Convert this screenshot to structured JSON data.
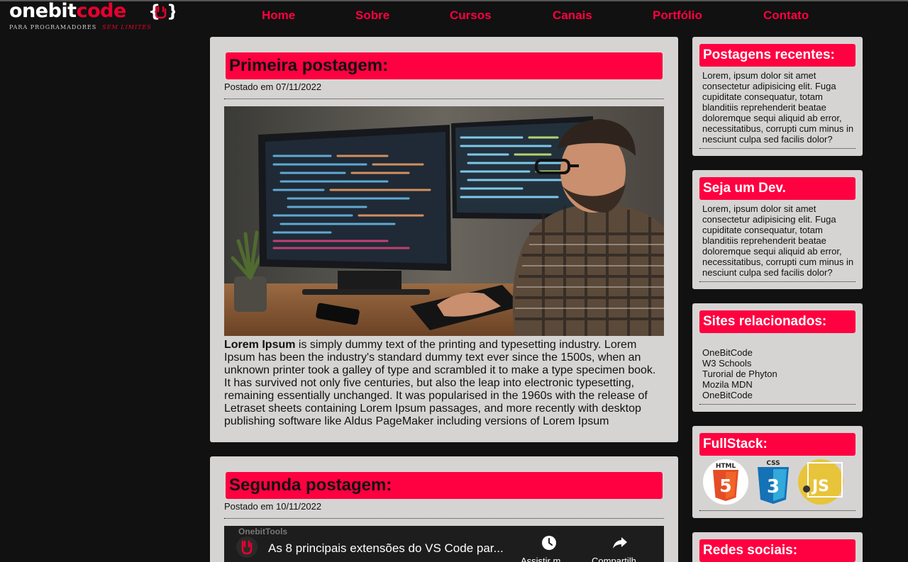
{
  "logo": {
    "part1": "onebit",
    "part2": "code",
    "tagline": "PARA PROGRAMADORES",
    "tagline_em": "SEM LIMITES"
  },
  "nav": [
    "Home",
    "Sobre",
    "Cursos",
    "Canais",
    "Portfólio",
    "Contato"
  ],
  "posts": [
    {
      "title": "Primeira postagem:",
      "date": "Postado em 07/11/2022",
      "text_bold": "Lorem Ipsum",
      "text": " is simply dummy text of the printing and typesetting industry. Lorem Ipsum has been the industry's standard dummy text ever since the 1500s, when an unknown printer took a galley of type and scrambled it to make a type specimen book. It has survived not only five centuries, but also the leap into electronic typesetting, remaining essentially unchanged. It was popularised in the 1960s with the release of Letraset sheets containing Lorem Ipsum passages, and more recently with desktop publishing software like Aldus PageMaker including versions of Lorem Ipsum"
    },
    {
      "title": "Segunda postagem:",
      "date": "Postado em 10/11/2022",
      "video": {
        "channel": "OnebitTools",
        "title": "As 8 principais extensões do VS Code par...",
        "watch_later": "Assistir m...",
        "share": "Compartilh..."
      }
    }
  ],
  "sidebar": [
    {
      "title": "Postagens recentes:",
      "text": "Lorem, ipsum dolor sit amet consectetur adipisicing elit. Fuga cupiditate consequatur, totam blanditiis reprehenderit beatae doloremque sequi aliquid ab error, necessitatibus, corrupti cum minus in nesciunt culpa sed facilis dolor?"
    },
    {
      "title": "Seja um Dev.",
      "text": "Lorem, ipsum dolor sit amet consectetur adipisicing elit. Fuga cupiditate consequatur, totam blanditiis reprehenderit beatae doloremque sequi aliquid ab error, necessitatibus, corrupti cum minus in nesciunt culpa sed facilis dolor?"
    },
    {
      "title": "Sites relacionados:",
      "links": [
        "OneBitCode",
        "W3 Schools",
        "Turorial de Phyton",
        "Mozila MDN",
        "OneBitCode"
      ]
    },
    {
      "title": "FullStack:",
      "badges": [
        "HTML",
        "CSS",
        "JS"
      ],
      "badge_numbers": [
        "5",
        "3"
      ]
    },
    {
      "title": "Redes sociais:"
    }
  ],
  "colors": {
    "accent": "#ff0040",
    "background": "#111111",
    "card": "#d6d4d3",
    "html5": "#e44d26",
    "css3": "#1572b6",
    "js": "#e8c43a"
  }
}
